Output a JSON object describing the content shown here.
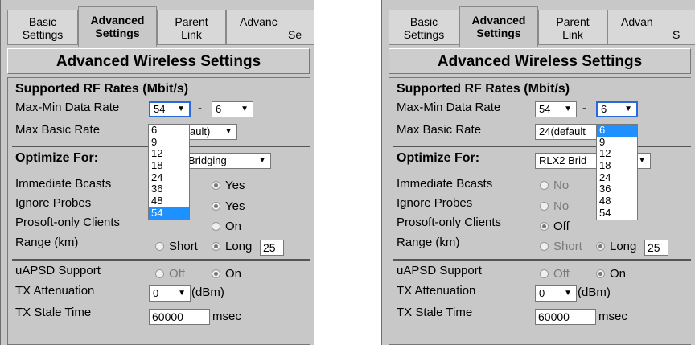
{
  "tabs": [
    "Basic Settings",
    "Advanced Settings",
    "Parent Link",
    "Advanced Se..."
  ],
  "tab_labels": [
    {
      "l1": "Basic",
      "l2": "Settings"
    },
    {
      "l1": "Advanced",
      "l2": "Settings"
    },
    {
      "l1": "Parent",
      "l2": "Link"
    },
    {
      "l1": "Advanc",
      "l2": "Se"
    }
  ],
  "tab_labels_right": [
    {
      "l1": "Basic",
      "l2": "Settings"
    },
    {
      "l1": "Advanced",
      "l2": "Settings"
    },
    {
      "l1": "Parent",
      "l2": "Link"
    },
    {
      "l1": "Advan",
      "l2": "S"
    }
  ],
  "heading": "Advanced Wireless Settings",
  "rf_section": "Supported RF Rates (Mbit/s)",
  "labels": {
    "max_min": "Max-Min Data Rate",
    "max_basic": "Max Basic Rate",
    "optimize": "Optimize For:",
    "immediate": "Immediate Bcasts",
    "ignore": "Ignore Probes",
    "prosoft": "Prosoft-only Clients",
    "range": "Range (km)",
    "uapsd": "uAPSD Support",
    "tx_att": "TX Attenuation",
    "tx_stale": "TX Stale Time"
  },
  "dash": "-",
  "left": {
    "max_rate": "54",
    "min_rate": "6",
    "max_basic_partial": "ault)",
    "optimize_partial": "Bridging",
    "immediate_value": "Yes",
    "ignore_value": "Yes",
    "prosoft_value": "On",
    "range_short": "Short",
    "range_long": "Long",
    "range_value": "25",
    "uapsd_off": "Off",
    "uapsd_on": "On",
    "tx_att_value": "0",
    "tx_att_unit": "(dBm)",
    "tx_stale_value": "60000",
    "tx_stale_unit": "msec",
    "dropdown_options": [
      "6",
      "9",
      "12",
      "18",
      "24",
      "36",
      "48",
      "54"
    ],
    "dropdown_selected": "54"
  },
  "right": {
    "max_rate": "54",
    "min_rate": "6",
    "max_basic_partial": "24(default",
    "optimize_partial": "RLX2 Brid",
    "immediate_value": "No",
    "ignore_value": "No",
    "prosoft_value": "Off",
    "range_short": "Short",
    "range_long": "Long",
    "range_value": "25",
    "uapsd_off": "Off",
    "uapsd_on": "On",
    "tx_att_value": "0",
    "tx_att_unit": "(dBm)",
    "tx_stale_value": "60000",
    "tx_stale_unit": "msec",
    "dropdown_options": [
      "6",
      "9",
      "12",
      "18",
      "24",
      "36",
      "48",
      "54"
    ],
    "dropdown_selected": "6"
  },
  "icons": {
    "dropdown_arrow": "triangle-down-icon",
    "radio": "radio-icon"
  },
  "colors": {
    "highlight": "#1e90ff",
    "focus_border": "#2a6ad8",
    "panel_bg": "#c8c8c8"
  }
}
